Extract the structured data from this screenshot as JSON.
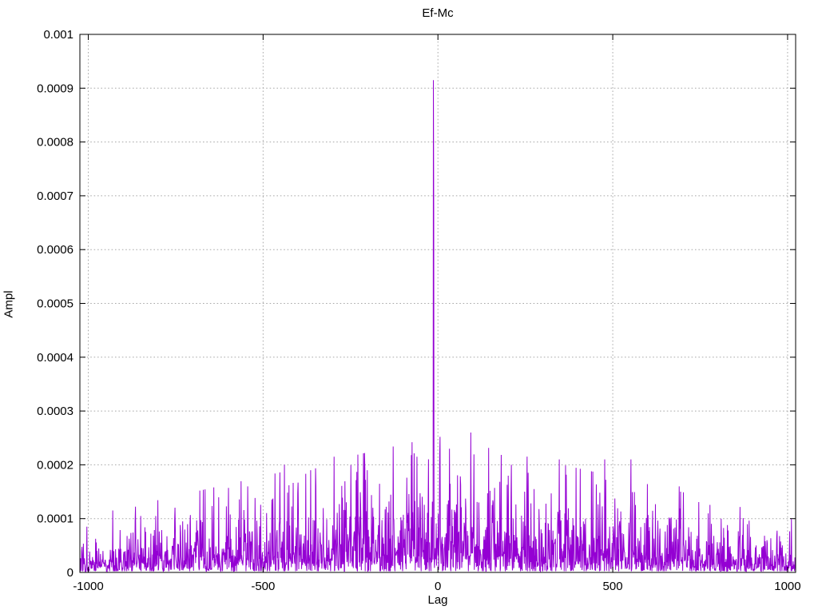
{
  "chart_data": {
    "type": "line",
    "title": "Ef-Mc",
    "xlabel": "Lag",
    "ylabel": "Ampl",
    "xlim": [
      -1024,
      1023
    ],
    "ylim": [
      0,
      0.001
    ],
    "grid": true,
    "legend_position": "none",
    "x_ticks": [
      {
        "value": -1000,
        "label": "-1000"
      },
      {
        "value": -500,
        "label": "-500"
      },
      {
        "value": 0,
        "label": "0"
      },
      {
        "value": 500,
        "label": "500"
      },
      {
        "value": 1000,
        "label": "1000"
      }
    ],
    "y_ticks": [
      {
        "value": 0,
        "label": "0"
      },
      {
        "value": 0.0001,
        "label": "0.0001"
      },
      {
        "value": 0.0002,
        "label": "0.0002"
      },
      {
        "value": 0.0003,
        "label": "0.0003"
      },
      {
        "value": 0.0004,
        "label": "0.0004"
      },
      {
        "value": 0.0005,
        "label": "0.0005"
      },
      {
        "value": 0.0006,
        "label": "0.0006"
      },
      {
        "value": 0.0007,
        "label": "0.0007"
      },
      {
        "value": 0.0008,
        "label": "0.0008"
      },
      {
        "value": 0.0009,
        "label": "0.0009"
      },
      {
        "value": 0.001,
        "label": "0.001"
      }
    ],
    "series": [
      {
        "name": "Ef-Mc",
        "color": "#9400d3",
        "n_points": 2048,
        "main_peak": {
          "lag": -13,
          "ampl": 0.000915
        },
        "shoulder_peak": {
          "lag": -12,
          "ampl": 0.000672
        },
        "notable_peaks": [
          {
            "lag": 94,
            "ampl": 0.00026
          },
          {
            "lag": 33,
            "ampl": 0.00023
          },
          {
            "lag": 5,
            "ampl": 0.00022
          },
          {
            "lag": -60,
            "ampl": 0.000215
          },
          {
            "lag": -297,
            "ampl": 0.000215
          },
          {
            "lag": 210,
            "ampl": 0.0002
          },
          {
            "lag": 347,
            "ampl": 0.00021
          },
          {
            "lag": 477,
            "ampl": 0.00021
          },
          {
            "lag": 552,
            "ampl": 0.00021
          },
          {
            "lag": -439,
            "ampl": 0.0002
          },
          {
            "lag": -364,
            "ampl": 0.00019
          },
          {
            "lag": -202,
            "ampl": 0.00019
          },
          {
            "lag": 690,
            "ampl": 0.00016
          },
          {
            "lag": -544,
            "ampl": 0.00016
          },
          {
            "lag": 810,
            "ampl": 0.0001
          },
          {
            "lag": -850,
            "ampl": 0.000105
          }
        ],
        "noise_envelope": {
          "shape": "triangular",
          "center_mean": 5.5e-05,
          "edge_mean": 2.2e-05,
          "floor": 2.2e-06,
          "peak_cap_ratio": 4.6
        },
        "random_seed": 77
      }
    ],
    "colors": {
      "line": "#9400d3",
      "grid": "#a8a8a8",
      "border": "#000000",
      "background": "#ffffff",
      "text": "#000000"
    }
  }
}
